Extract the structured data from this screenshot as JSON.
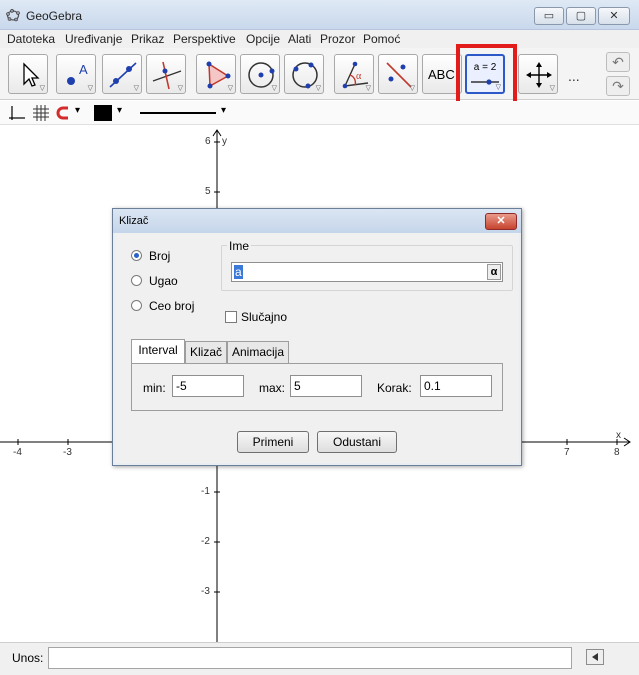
{
  "window": {
    "title": "GeoGebra",
    "min_glyph": "▭",
    "max_glyph": "▢",
    "close_glyph": "✕"
  },
  "menu": [
    "Datoteka",
    "Uređivanje",
    "Prikaz",
    "Perspektive",
    "Opcije",
    "Alati",
    "Prozor",
    "Pomoć"
  ],
  "toolbar": {
    "text_tool_label": "ABC",
    "slider_tool_label": "a = 2",
    "more": "...",
    "undo_glyph": "↶",
    "redo_glyph": "↷",
    "highlight_color": "#e21b1b",
    "selected_color": "#2c58c8"
  },
  "stylebar": {
    "line_style_glyph": "▾",
    "color_glyph": "▾"
  },
  "graphics": {
    "y_label": "y",
    "x_label": "x",
    "x_ticks": [
      "-4",
      "-3",
      "7",
      "8"
    ],
    "y_ticks": [
      "6",
      "5",
      "-1",
      "-2",
      "-3"
    ]
  },
  "input_bar": {
    "label": "Unos:",
    "value": ""
  },
  "dialog": {
    "title": "Klizač",
    "close_glyph": "✕",
    "radios": [
      {
        "label": "Broj",
        "checked": true
      },
      {
        "label": "Ugao",
        "checked": false
      },
      {
        "label": "Ceo broj",
        "checked": false
      }
    ],
    "name_group_label": "Ime",
    "name_value": "a",
    "alpha_glyph": "α",
    "random_label": "Slučajno",
    "tabs": [
      "Interval",
      "Klizač",
      "Animacija"
    ],
    "active_tab": "Interval",
    "min_label": "min:",
    "min_value": "-5",
    "max_label": "max:",
    "max_value": "5",
    "step_label": "Korak:",
    "step_value": "0.1",
    "apply_label": "Primeni",
    "cancel_label": "Odustani"
  }
}
